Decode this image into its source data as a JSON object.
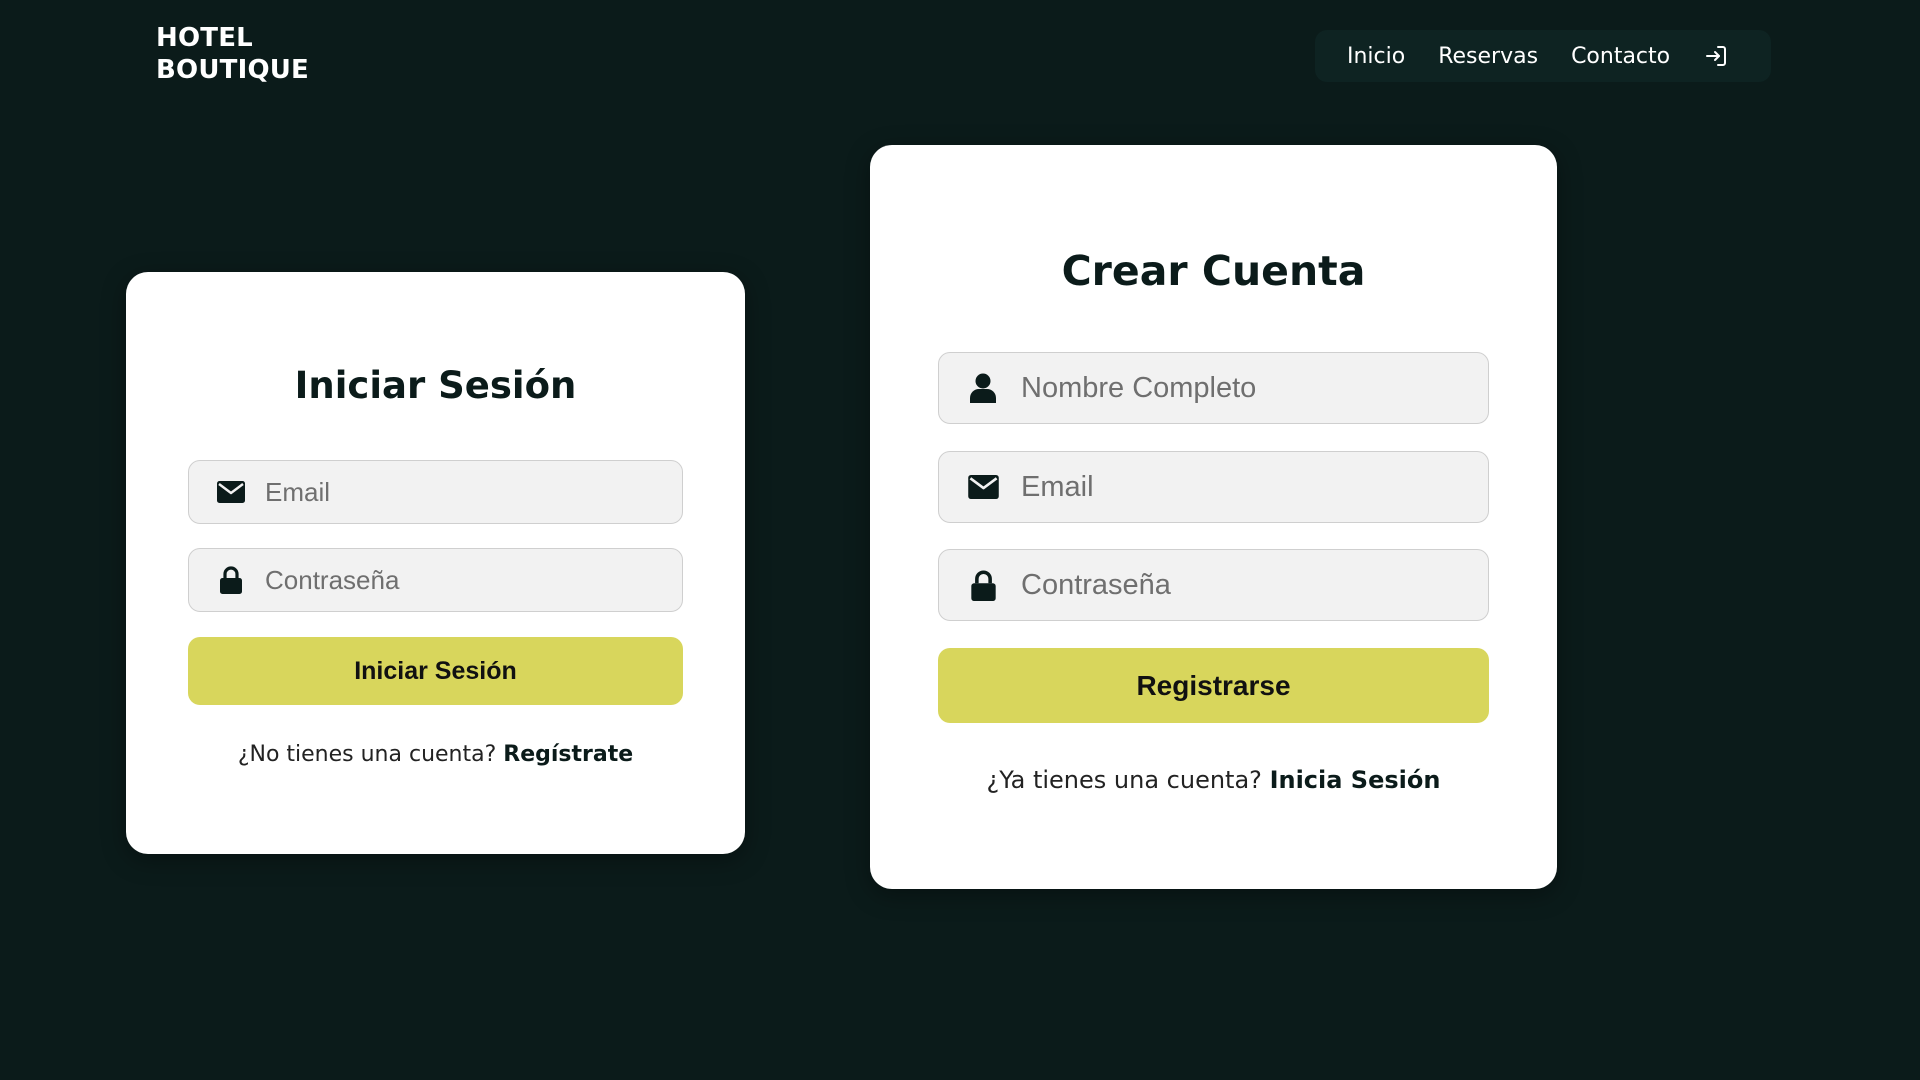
{
  "header": {
    "logo_line1": "HOTEL",
    "logo_line2": "BOUTIQUE",
    "nav": {
      "inicio": "Inicio",
      "reservas": "Reservas",
      "contacto": "Contacto",
      "login_icon": "login-arrow-icon"
    }
  },
  "login_card": {
    "title": "Iniciar Sesión",
    "email_placeholder": "Email",
    "email_value": "",
    "password_placeholder": "Contraseña",
    "password_value": "",
    "submit_label": "Iniciar Sesión",
    "switch_text": "¿No tienes una cuenta?",
    "switch_link": "Regístrate"
  },
  "register_card": {
    "title": "Crear Cuenta",
    "name_placeholder": "Nombre Completo",
    "name_value": "",
    "email_placeholder": "Email",
    "email_value": "",
    "password_placeholder": "Contraseña",
    "password_value": "",
    "submit_label": "Registrarse",
    "switch_text": "¿Ya tienes una cuenta?",
    "switch_link": "Inicia Sesión"
  },
  "icons": {
    "email": "envelope-icon",
    "password": "lock-icon",
    "name": "user-icon"
  },
  "colors": {
    "background": "#0b1b1a",
    "accent": "#d8d65c",
    "card": "#ffffff",
    "input_bg": "#f2f2f2"
  }
}
